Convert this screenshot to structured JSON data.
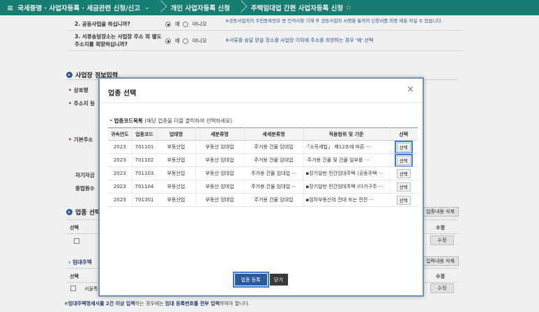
{
  "topbar": {
    "crumb1": "국세증명 · 사업자등록 · 세금관련 신청/신고",
    "crumb2": "개인 사업자등록 신청",
    "crumb3": "주택임대업 간편 사업자등록 신청"
  },
  "questions": [
    {
      "text": "2. 공동사업을 하십니까?",
      "yes": "예",
      "no": "아니오",
      "note": "※공동사업자의 주민등록번호 등 인적사항 기재 후 공동사업자 서명을 통하여 신청서를 최종 제출 하실 수 있습니다."
    },
    {
      "text": "3. 서류송달장소는 사업장 주소 외 별도 주소지를 희망하십니까?",
      "yes": "예",
      "no": "아니오",
      "note": "※서류를 송달 받을 장소를 사업장 이외에 주소를 희망하는 경우 '예' 선택"
    }
  ],
  "section": {
    "title": "사업장 정보입력"
  },
  "form_labels": {
    "name": "상호명",
    "address": "주소지 등",
    "basic_address": "기본주소",
    "own_capital": "자기자금",
    "employees": "종업원수"
  },
  "industry_section": {
    "title": "업종 선택",
    "col_select": "선택",
    "col_edit": "수정",
    "delete_btn": "업종내용 삭제",
    "edit_btn": "수정"
  },
  "lease_section": {
    "title": "임대주택",
    "col_select": "선택",
    "row_text": "서울특",
    "col_edit": "수정",
    "delete_btn": "입력내용 삭제",
    "edit_btn": "수정"
  },
  "bottom_note": {
    "prefix": "※",
    "b1": "임대주택명세서를 2건 이상 입력",
    "t1": "하는 경우에는 ",
    "b2": "임대 등록번호를 전부 입력",
    "t2": "하여야 합니다."
  },
  "modal": {
    "title": "업종 선택",
    "close": "×",
    "list_caption": "업종코드목록",
    "list_hint": "(해당 업종을 더블 클릭하여 선택하세요)",
    "headers": [
      "귀속연도",
      "업종코드",
      "업태명",
      "세분류명",
      "세세분류명",
      "적용범위 및 기준",
      "선택"
    ],
    "rows": [
      {
        "year": "2023",
        "code": "701101",
        "type": "부동산업",
        "sub": "부동산 임대업",
        "subsub": "주거용 건물 임대업",
        "scope": "·「소득세법」 제12조에 따른 ···",
        "select": "선택"
      },
      {
        "year": "2023",
        "code": "701102",
        "type": "부동산업",
        "sub": "부동산 임대업",
        "subsub": "주거용 건물 임대업",
        "scope": "·주거용 건물 및 건물 일부를 ···",
        "select": "선택"
      },
      {
        "year": "2023",
        "code": "701103",
        "type": "부동산업",
        "sub": "부동산 임대업",
        "subsub": "주거용 건물 임대업 ···",
        "scope": "▪장기일반 민간임대주택 (공동주택 ···",
        "select": "선택"
      },
      {
        "year": "2023",
        "code": "701104",
        "type": "부동산업",
        "sub": "부동산 임대업",
        "subsub": "주거용 건물 임대업 ···",
        "scope": "▪장기일반 민간임대주택 (다가구주 ···",
        "select": "선택"
      },
      {
        "year": "2023",
        "code": "701301",
        "type": "부동산업",
        "sub": "부동산 임대업",
        "subsub": "주거용 건물 임대업",
        "scope": "▪임차부동산의 전대 또는 전전 ···",
        "select": "선택"
      }
    ],
    "register_btn": "업종 등록",
    "close_btn": "닫기"
  }
}
